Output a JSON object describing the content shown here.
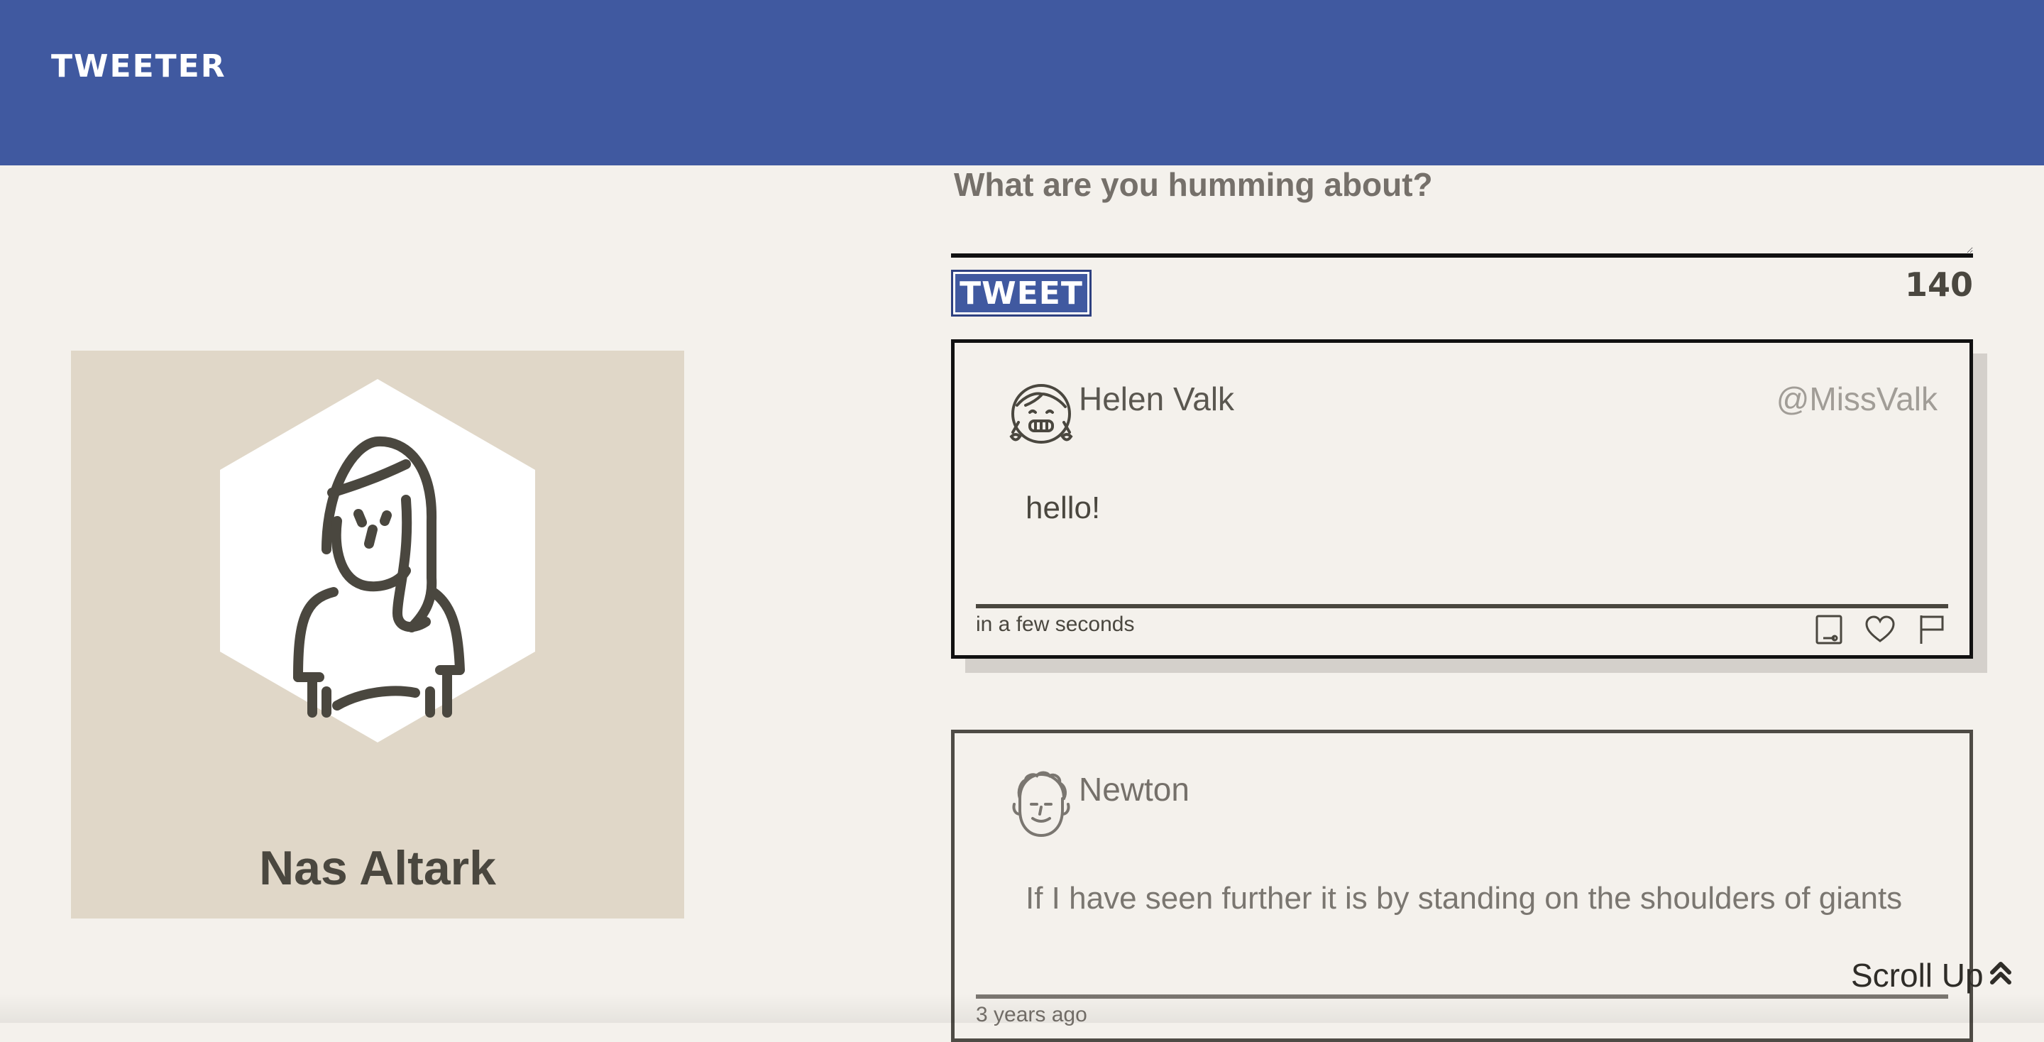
{
  "header": {
    "brand": "TWEETER"
  },
  "profile": {
    "name": "Nas Altark"
  },
  "composer": {
    "placeholder": "What are you humming about?",
    "button_label": "TWEET",
    "chars_left": "140"
  },
  "tweets": [
    {
      "author": "Helen Valk",
      "handle": "@MissValk",
      "text": "hello!",
      "time": "in a few seconds"
    },
    {
      "author": "Newton",
      "handle": "",
      "text": "If I have seen further it is by standing on the shoulders of giants",
      "time": "3 years ago"
    }
  ],
  "scroll": {
    "label": "Scroll Up"
  },
  "colors": {
    "brand": "#4059a0",
    "background": "#f4f1ec",
    "card": "#e0d7c8",
    "text": "#4a473f"
  },
  "icons": [
    "retweet-icon",
    "heart-icon",
    "flag-icon",
    "chevron-double-up-icon"
  ]
}
